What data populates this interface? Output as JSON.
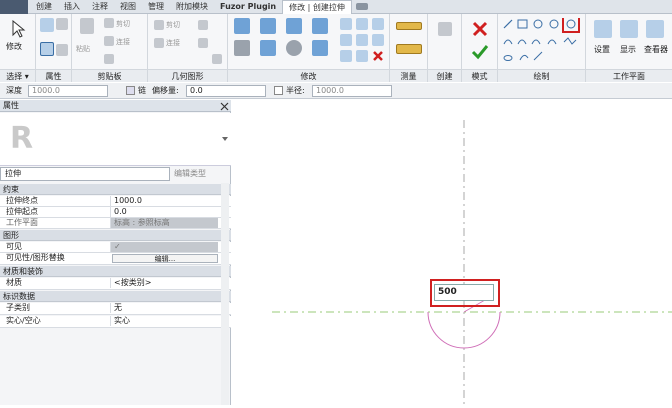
{
  "tabs": [
    "创建",
    "插入",
    "注释",
    "视图",
    "管理",
    "附加模块",
    "Fuzor Plugin",
    "修改 | 创建拉伸"
  ],
  "ribbon": {
    "groups": [
      {
        "name": "select",
        "label": "选择 ▾"
      },
      {
        "name": "properties",
        "label": "属性"
      },
      {
        "name": "clipboard",
        "label": "剪贴板"
      },
      {
        "name": "geometry",
        "label": "几何图形"
      },
      {
        "name": "modify",
        "label": "修改"
      },
      {
        "name": "measure",
        "label": "测量"
      },
      {
        "name": "create",
        "label": "创建"
      },
      {
        "name": "mode",
        "label": "模式"
      },
      {
        "name": "draw",
        "label": "绘制"
      },
      {
        "name": "workplane",
        "label": "工作平面"
      }
    ],
    "modify_label": "修改",
    "paste_label": "粘贴",
    "cut_label": "剪切",
    "join_label": "连接",
    "workplane_buttons": [
      "设置",
      "显示",
      "查看器"
    ]
  },
  "optbar": {
    "depth_label": "深度",
    "depth_value": "1000.0",
    "chain_label": "链",
    "offset_label": "偏移量:",
    "offset_value": "0.0",
    "radius_label": "半径:",
    "radius_value": "1000.0"
  },
  "properties": {
    "title": "属性",
    "type_selector": "拉伸",
    "edit_type": "编辑类型",
    "sections": [
      {
        "label": "约束",
        "rows": [
          {
            "k": "拉伸终点",
            "v": "1000.0"
          },
          {
            "k": "拉伸起点",
            "v": "0.0"
          },
          {
            "k": "工作平面",
            "v": "标高 : 参照标高"
          }
        ]
      },
      {
        "label": "图形",
        "rows": [
          {
            "k": "可见",
            "v": "✓"
          },
          {
            "k": "可见性/图形替换",
            "v": "编辑..."
          }
        ]
      },
      {
        "label": "材质和装饰",
        "rows": [
          {
            "k": "材质",
            "v": "<按类别>"
          }
        ]
      },
      {
        "label": "标识数据",
        "rows": [
          {
            "k": "子类别",
            "v": "无"
          },
          {
            "k": "实心/空心",
            "v": "实心"
          }
        ]
      }
    ]
  },
  "canvas": {
    "dimension_value": "500"
  }
}
